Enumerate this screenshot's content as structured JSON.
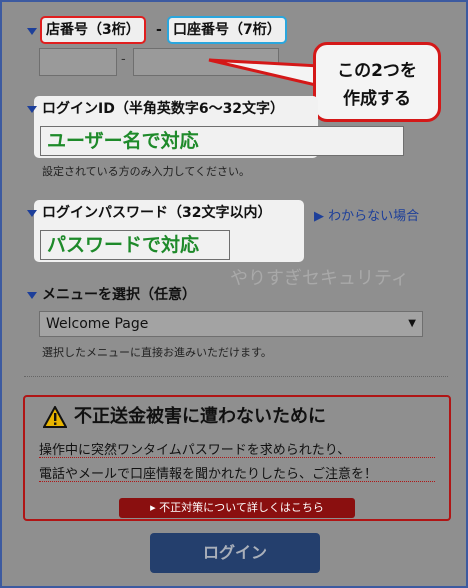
{
  "store_number": {
    "label": "店番号（3桁）",
    "separator": "-",
    "value": ""
  },
  "account_number": {
    "label": "口座番号（7桁）",
    "separator": "-",
    "value": ""
  },
  "callout": {
    "line1": "この2つを",
    "line2": "作成する"
  },
  "login_id": {
    "label": "ログインID（半角英数字6～32文字）",
    "annotation": "ユーザー名で対応",
    "hint": "設定されている方のみ入力してください。"
  },
  "password": {
    "label": "ログインパスワード（32文字以内）",
    "annotation": "パスワードで対応",
    "help_link": "わからない場合"
  },
  "watermark": "やりすぎセキュリティ",
  "menu": {
    "label": "メニューを選択（任意）",
    "selected": "Welcome Page",
    "hint": "選択したメニューに直接お進みいただけます。"
  },
  "warning": {
    "icon": "warning-icon",
    "title": "不正送金被害に遭わないために",
    "line1": "操作中に突然ワンタイムパスワードを求められたり、",
    "line2": "電話やメールで口座情報を聞かれたりしたら、ご注意を！",
    "link": "不正対策について詳しくはこちら"
  },
  "login_button": "ログイン",
  "colors": {
    "accent_red": "#e01e1e",
    "accent_blue": "#2aa6dd",
    "annotation_green": "#1e8a2a",
    "login_bg": "#243f6d",
    "warning_red": "#b01515"
  }
}
